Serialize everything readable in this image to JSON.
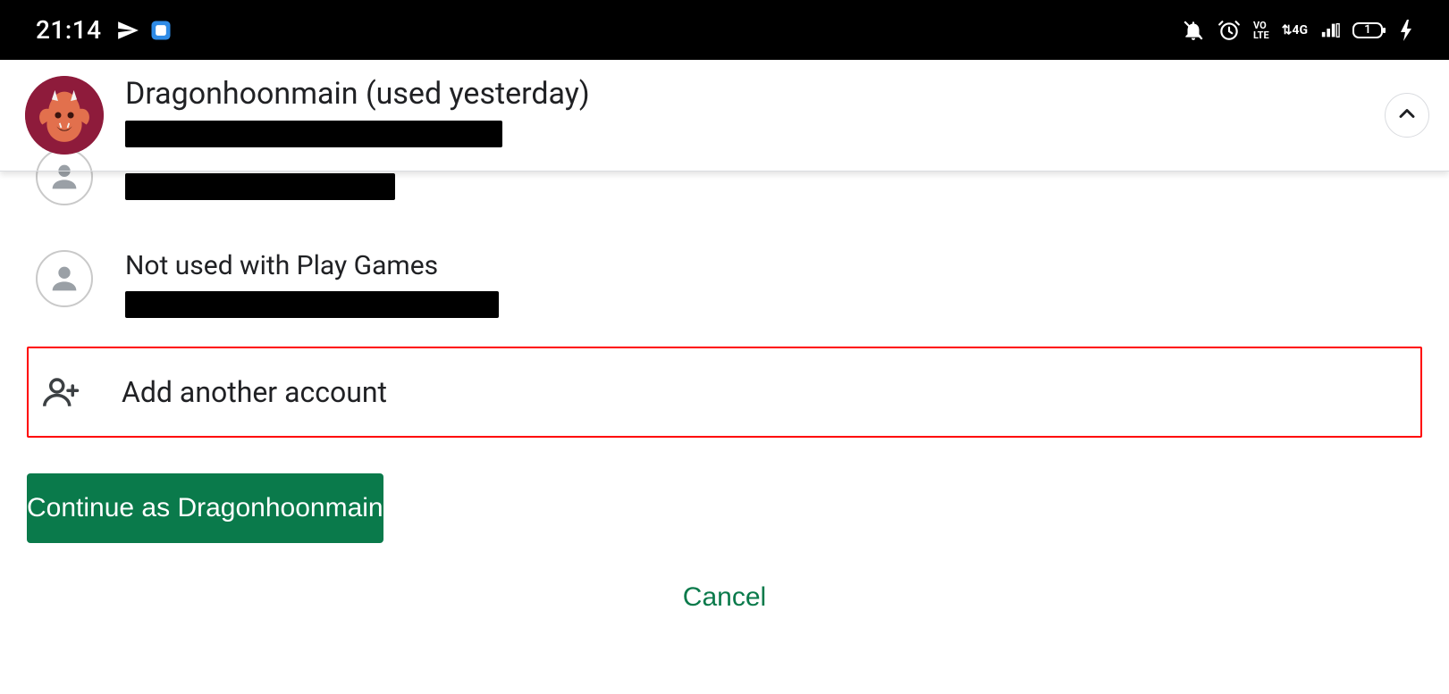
{
  "status": {
    "time": "21:14",
    "left_icons": [
      "paper-plane-icon",
      "app-square-icon"
    ],
    "right_icons": [
      "bell-off-icon",
      "alarm-icon",
      "volte-icon",
      "4g-icon",
      "signal-icon",
      "battery-icon",
      "charging-icon"
    ],
    "battery_text": "1"
  },
  "header": {
    "display_name": "Dragonhoonmain (used yesterday)"
  },
  "accounts": [
    {
      "title": ""
    },
    {
      "title": "Not used with Play Games"
    }
  ],
  "add_account": {
    "label": "Add another account"
  },
  "continue": {
    "label": "Continue as Dragonhoonmain"
  },
  "cancel": {
    "label": "Cancel"
  },
  "colors": {
    "accent": "#0a7a4b",
    "highlight_border": "#ff0000"
  }
}
